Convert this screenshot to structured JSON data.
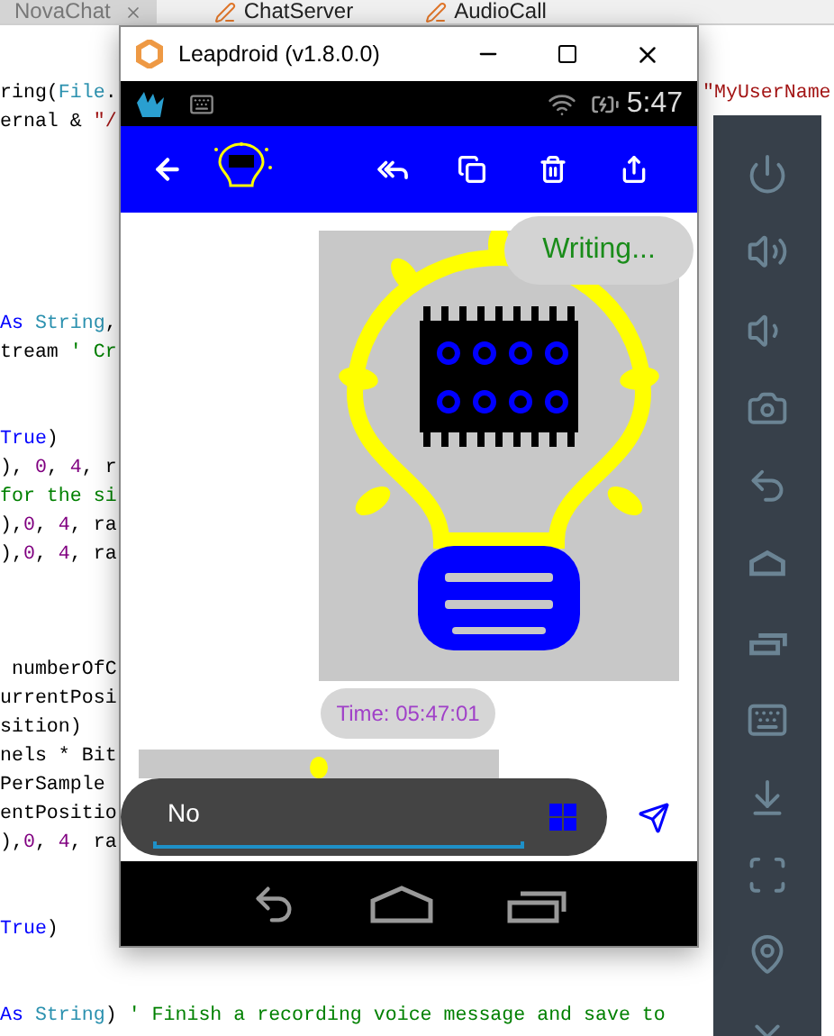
{
  "ide": {
    "tabs": [
      {
        "label": "NovaChat",
        "selected": true,
        "closable": true
      },
      {
        "label": "ChatServer",
        "selected": false,
        "closable": false
      },
      {
        "label": "AudioCall",
        "selected": false,
        "closable": false
      }
    ],
    "code_lines": [
      {
        "kind": "code",
        "segments": [
          {
            "kind": "plain",
            "text": "ring("
          },
          {
            "kind": "type",
            "text": "File"
          },
          {
            "kind": "plain",
            "text": "."
          }
        ],
        "tail": [
          {
            "kind": "string",
            "text": "\"MyUserName"
          }
        ]
      },
      {
        "kind": "code",
        "segments": [
          {
            "kind": "plain",
            "text": "ernal & "
          },
          {
            "kind": "string",
            "text": "\"/"
          }
        ]
      },
      {
        "kind": "blank"
      },
      {
        "kind": "blank"
      },
      {
        "kind": "blank"
      },
      {
        "kind": "blank"
      },
      {
        "kind": "blank"
      },
      {
        "kind": "blank"
      },
      {
        "kind": "code",
        "segments": [
          {
            "kind": "keyword",
            "text": "As "
          },
          {
            "kind": "type",
            "text": "String"
          },
          {
            "kind": "plain",
            "text": ","
          }
        ]
      },
      {
        "kind": "code",
        "segments": [
          {
            "kind": "plain",
            "text": "tream "
          },
          {
            "kind": "comment",
            "text": "' Cr"
          }
        ]
      },
      {
        "kind": "blank"
      },
      {
        "kind": "blank"
      },
      {
        "kind": "code",
        "segments": [
          {
            "kind": "keyword",
            "text": "True"
          },
          {
            "kind": "plain",
            "text": ")"
          }
        ]
      },
      {
        "kind": "code",
        "segments": [
          {
            "kind": "plain",
            "text": "), "
          },
          {
            "kind": "number",
            "text": "0"
          },
          {
            "kind": "plain",
            "text": ", "
          },
          {
            "kind": "number",
            "text": "4"
          },
          {
            "kind": "plain",
            "text": ", r"
          }
        ]
      },
      {
        "kind": "code",
        "segments": [
          {
            "kind": "comment",
            "text": "for the si"
          }
        ]
      },
      {
        "kind": "code",
        "segments": [
          {
            "kind": "plain",
            "text": "),"
          },
          {
            "kind": "number",
            "text": "0"
          },
          {
            "kind": "plain",
            "text": ", "
          },
          {
            "kind": "number",
            "text": "4"
          },
          {
            "kind": "plain",
            "text": ", ra"
          }
        ]
      },
      {
        "kind": "code",
        "segments": [
          {
            "kind": "plain",
            "text": "),"
          },
          {
            "kind": "number",
            "text": "0"
          },
          {
            "kind": "plain",
            "text": ", "
          },
          {
            "kind": "number",
            "text": "4"
          },
          {
            "kind": "plain",
            "text": ", ra"
          }
        ]
      },
      {
        "kind": "blank"
      },
      {
        "kind": "blank"
      },
      {
        "kind": "blank"
      },
      {
        "kind": "code",
        "segments": [
          {
            "kind": "plain",
            "text": " numberOfC"
          }
        ]
      },
      {
        "kind": "code",
        "segments": [
          {
            "kind": "plain",
            "text": "urrentPosi"
          }
        ]
      },
      {
        "kind": "code",
        "segments": [
          {
            "kind": "plain",
            "text": "sition)"
          }
        ]
      },
      {
        "kind": "code",
        "segments": [
          {
            "kind": "plain",
            "text": "nels * Bit"
          }
        ]
      },
      {
        "kind": "code",
        "segments": [
          {
            "kind": "plain",
            "text": "PerSample"
          }
        ]
      },
      {
        "kind": "code",
        "segments": [
          {
            "kind": "plain",
            "text": "entPositio"
          }
        ]
      },
      {
        "kind": "code",
        "segments": [
          {
            "kind": "plain",
            "text": "),"
          },
          {
            "kind": "number",
            "text": "0"
          },
          {
            "kind": "plain",
            "text": ", "
          },
          {
            "kind": "number",
            "text": "4"
          },
          {
            "kind": "plain",
            "text": ", ra"
          }
        ]
      },
      {
        "kind": "blank"
      },
      {
        "kind": "blank"
      },
      {
        "kind": "code",
        "segments": [
          {
            "kind": "keyword",
            "text": "True"
          },
          {
            "kind": "plain",
            "text": ")"
          }
        ]
      },
      {
        "kind": "blank"
      },
      {
        "kind": "blank"
      },
      {
        "kind": "code",
        "segments": [
          {
            "kind": "keyword",
            "text": "As "
          },
          {
            "kind": "type",
            "text": "String"
          },
          {
            "kind": "plain",
            "text": ") "
          },
          {
            "kind": "comment",
            "text": "' Finish a recording voice message and save to"
          }
        ]
      }
    ]
  },
  "emulator": {
    "title": "Leapdroid (v1.8.0.0)",
    "status_bar": {
      "time": "5:47"
    },
    "typing_indicator": "Writing...",
    "messages": [
      {
        "kind": "image"
      },
      {
        "kind": "time",
        "text": "Time: 05:47:01"
      },
      {
        "kind": "image_partial"
      }
    ],
    "composer": {
      "value": "No"
    }
  }
}
